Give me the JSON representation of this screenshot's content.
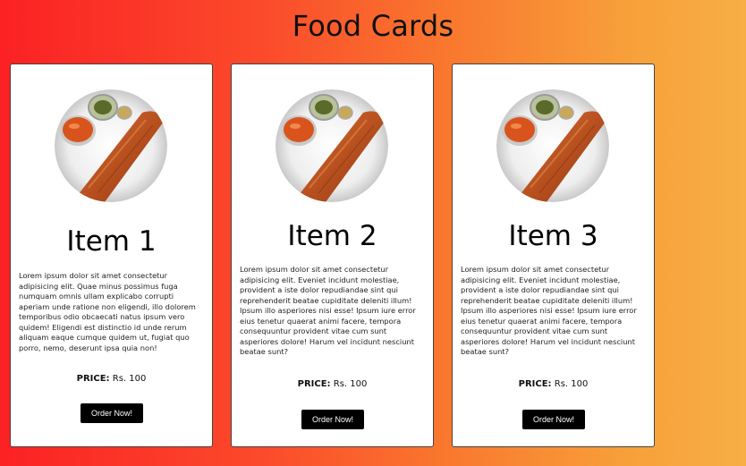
{
  "page": {
    "title": "Food Cards"
  },
  "cards": [
    {
      "title": "Item 1",
      "image": "masala-dosa-plate",
      "description": "Lorem ipsum dolor sit amet consectetur adipisicing elit. Quae minus possimus fuga numquam omnis ullam explicabo corrupti aperiam unde ratione non eligendi, illo dolorem temporibus odio obcaecati natus ipsum vero quidem! Eligendi est distinctio id unde rerum aliquam eaque cumque quidem ut, fugiat quo porro, nemo, deserunt ipsa quia non!",
      "price_label": "PRICE:",
      "price_value": "Rs. 100",
      "button_label": "Order Now!"
    },
    {
      "title": "Item 2",
      "image": "masala-dosa-plate",
      "description": "Lorem ipsum dolor sit amet consectetur adipisicing elit. Eveniet incidunt molestiae, provident a iste dolor repudiandae sint qui reprehenderit beatae cupiditate deleniti illum! Ipsum illo asperiores nisi esse! Ipsum iure error eius tenetur quaerat animi facere, tempora consequuntur provident vitae cum sunt asperiores dolore! Harum vel incidunt nesciunt beatae sunt?",
      "price_label": "PRICE:",
      "price_value": "Rs. 100",
      "button_label": "Order Now!"
    },
    {
      "title": "Item 3",
      "image": "masala-dosa-plate",
      "description": "Lorem ipsum dolor sit amet consectetur adipisicing elit. Eveniet incidunt molestiae, provident a iste dolor repudiandae sint qui reprehenderit beatae cupiditate deleniti illum! Ipsum illo asperiores nisi esse! Ipsum iure error eius tenetur quaerat animi facere, tempora consequuntur provident vitae cum sunt asperiores dolore! Harum vel incidunt nesciunt beatae sunt?",
      "price_label": "PRICE:",
      "price_value": "Rs. 100",
      "button_label": "Order Now!"
    }
  ]
}
